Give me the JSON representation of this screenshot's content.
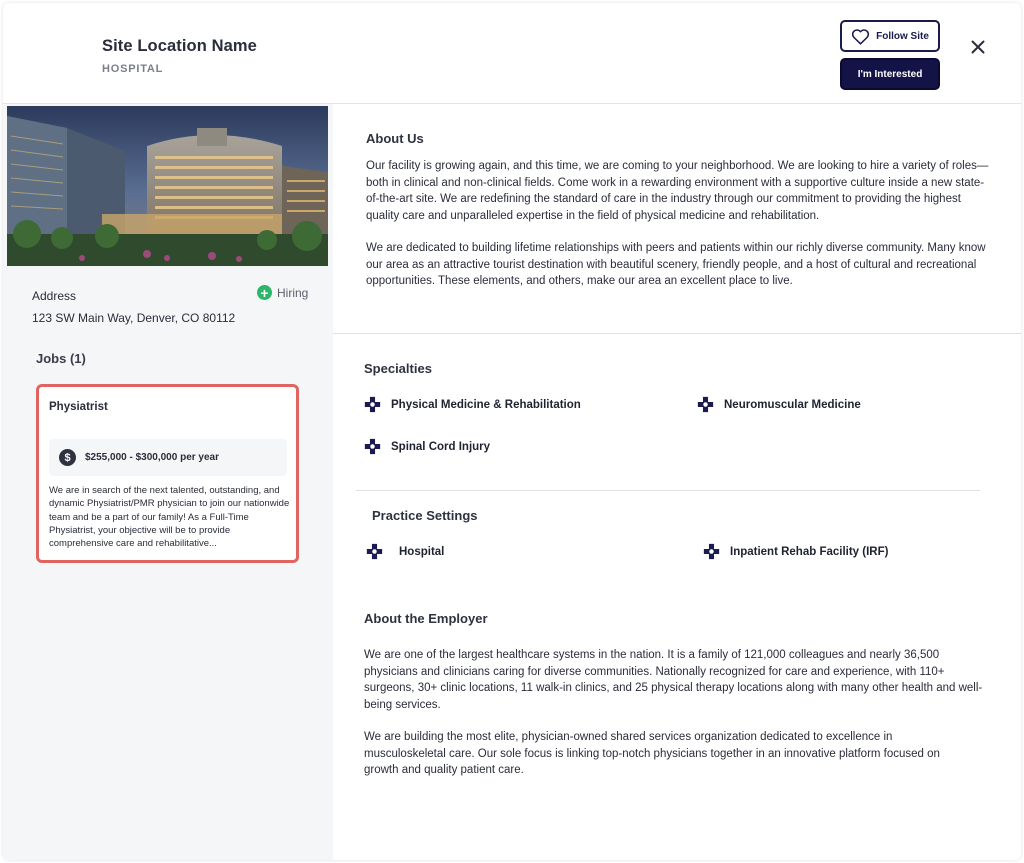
{
  "header": {
    "title": "Site Location Name",
    "subtitle": "HOSPITAL",
    "follow_label": "Follow Site",
    "interested_label": "I'm Interested",
    "close_icon": "close-icon"
  },
  "sidebar": {
    "address_label": "Address",
    "hiring_label": "Hiring",
    "address": "123 SW Main Way, Denver, CO 80112",
    "jobs_heading": "Jobs (1)",
    "job": {
      "title": "Physiatrist",
      "salary": "$255,000 - $300,000 per year",
      "description": "We are in search of the next talented, outstanding, and dynamic Physiatrist/PMR physician to join our nationwide team and be a part of our family! As a Full-Time Physiatrist, your objective will be to provide comprehensive care and rehabilitative..."
    }
  },
  "main": {
    "about_us": {
      "heading": "About Us",
      "p1": "Our facility is growing again, and this time, we are coming to your neighborhood. We are looking to hire a variety of roles—both in clinical and non-clinical fields. Come work in a rewarding environment with a supportive culture inside a new state-of-the-art site. We are redefining the standard of care in the industry through our commitment to providing the highest quality care and unparalleled expertise in the field of physical medicine and rehabilitation.",
      "p2": "We are dedicated to building lifetime relationships with peers and patients within our richly diverse community. Many know our area as an attractive tourist destination with beautiful scenery, friendly people, and a host of cultural and recreational opportunities. These elements, and others, make our area an excellent place to live."
    },
    "specialties": {
      "heading": "Specialties",
      "items": [
        "Physical Medicine & Rehabilitation",
        "Neuromuscular Medicine",
        "Spinal Cord Injury"
      ]
    },
    "practice_settings": {
      "heading": "Practice Settings",
      "items": [
        "Hospital",
        "Inpatient Rehab Facility (IRF)"
      ]
    },
    "about_employer": {
      "heading": "About the Employer",
      "p1": "We are one of the largest healthcare systems in the nation. It is a family of 121,000 colleagues and nearly 36,500 physicians and clinicians caring for diverse communities. Nationally recognized for care and experience, with 110+ surgeons, 30+ clinic locations, 11 walk-in clinics, and 25 physical therapy locations along with many other health and well-being services.",
      "p2": "We are building the most elite, physician-owned shared services organization dedicated to excellence in musculoskeletal care. Our sole focus is linking top-notch physicians together in an innovative platform focused on growth and quality patient care."
    }
  },
  "colors": {
    "navy": "#131347",
    "job_card_border": "#e0645f",
    "hiring_green": "#2db56a"
  }
}
